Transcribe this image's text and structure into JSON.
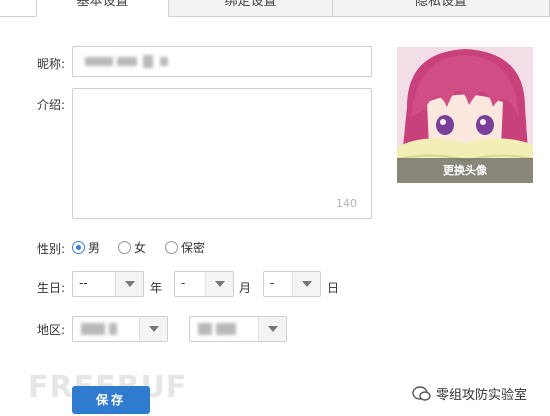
{
  "tabs": [
    {
      "label": "基本设置",
      "active": true
    },
    {
      "label": "绑定设置",
      "active": false
    },
    {
      "label": "隐私设置",
      "active": false
    }
  ],
  "form": {
    "nickname_label": "昵称:",
    "intro_label": "介绍:",
    "intro_counter": "140",
    "gender_label": "性别:",
    "gender_options": [
      "男",
      "女",
      "保密"
    ],
    "gender_selected": "男",
    "birthday_label": "生日:",
    "birthday": {
      "year": "--",
      "year_unit": "年",
      "month": "-",
      "month_unit": "月",
      "day": "-",
      "day_unit": "日"
    },
    "region_label": "地区:"
  },
  "avatar": {
    "change_label": "更换头像"
  },
  "save_label": "保存",
  "watermark": {
    "left": "FREEBUF",
    "right": "零组攻防实验室"
  },
  "colors": {
    "accent": "#2f7bd0",
    "radio": "#3a7fd5"
  }
}
